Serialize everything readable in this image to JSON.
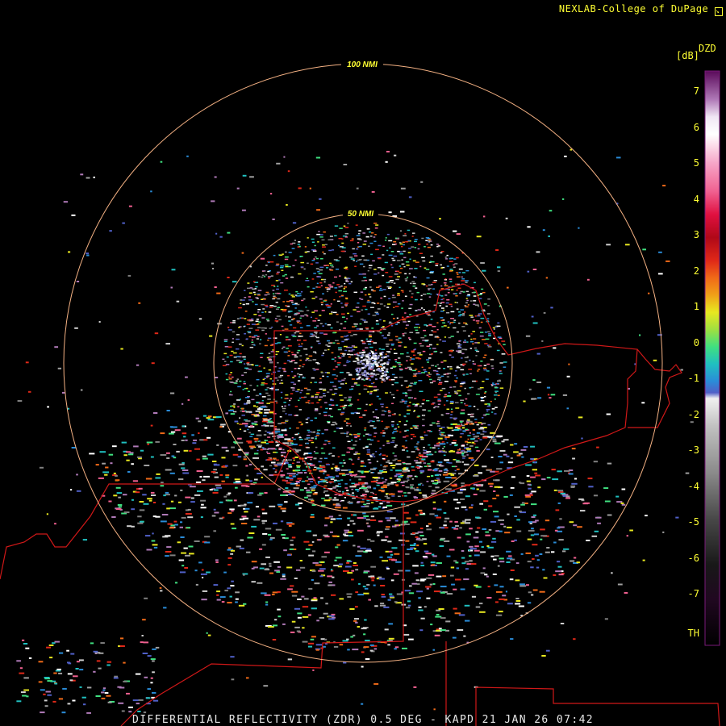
{
  "header": {
    "credit": "NEXLAB-College of DuPage",
    "credit_icon": "external-link-icon"
  },
  "footer": {
    "caption": "DIFFERENTIAL REFLECTIVITY (ZDR) 0.5 DEG - KAPD 21 JAN 26 07:42"
  },
  "range_rings": [
    {
      "label": "50 NMI",
      "range_nmi": 50
    },
    {
      "label": "100 NMI",
      "range_nmi": 100
    }
  ],
  "legend": {
    "product": "DZD",
    "unit": "[dB]",
    "ticks": [
      "7",
      "6",
      "5",
      "4",
      "3",
      "2",
      "1",
      "0",
      "-1",
      "-2",
      "-3",
      "-4",
      "-5",
      "-6",
      "-7",
      "TH"
    ]
  },
  "colors": {
    "ring": "#f4b183",
    "boundary": "#d01818",
    "label": "#ffff33",
    "background": "#000000"
  }
}
